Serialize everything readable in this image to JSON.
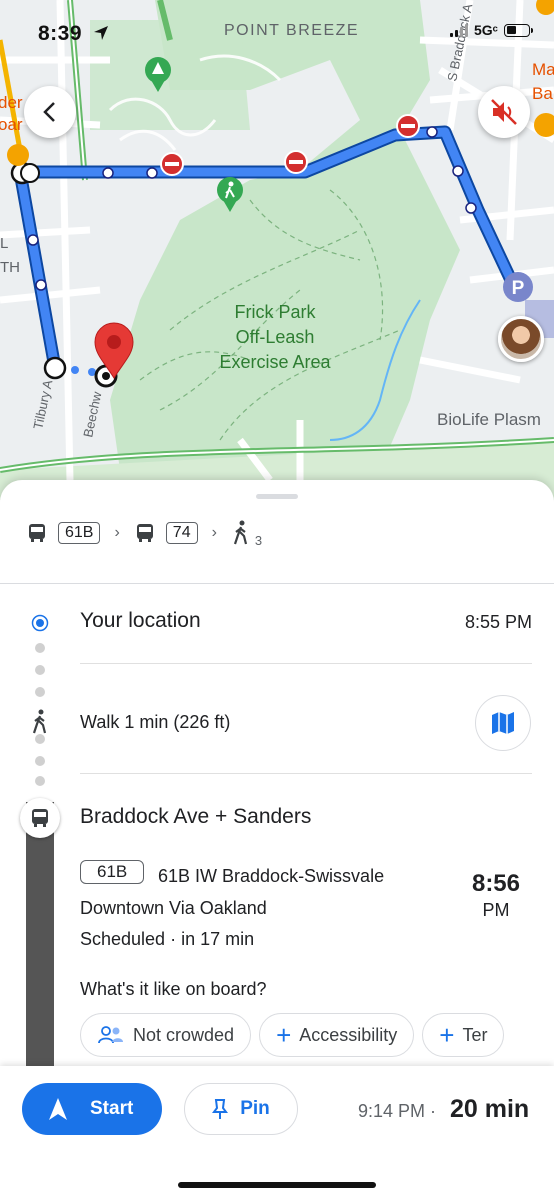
{
  "status_bar": {
    "time": "8:39",
    "network": "5Gᶜ"
  },
  "map": {
    "labels": {
      "neighborhood": "POINT BREEZE",
      "park": [
        "Frick Park",
        "Off-Leash",
        "Exercise Area"
      ],
      "place": "BioLife Plasm"
    },
    "street_labels": [
      "S Braddock A",
      "Tilbury A",
      "Beechw"
    ],
    "edge_labels": [
      "der",
      "oar",
      "Ma",
      "Ba",
      "L",
      "TH"
    ],
    "parking_label": "P",
    "route_color": "#1a73e8"
  },
  "summary": {
    "bus1": "61B",
    "bus2": "74",
    "walk_minutes": "3"
  },
  "steps": {
    "origin": {
      "label": "Your location",
      "time": "8:55 PM"
    },
    "walk": {
      "label": "Walk 1 min (226 ft)"
    },
    "stop": {
      "label": "Braddock Ave + Sanders"
    },
    "route": {
      "badge": "61B",
      "name": "61B IW Braddock-Swissvale",
      "destination": "Downtown Via Oakland",
      "schedule": "Scheduled · in 17 min",
      "depart_time": "8:56",
      "depart_ampm": "PM"
    },
    "crowd_question": "What's it like on board?",
    "chips": [
      "Not crowded",
      "Accessibility",
      "Ter"
    ]
  },
  "bottom": {
    "start_label": "Start",
    "pin_label": "Pin",
    "arrival": "9:14 PM ·",
    "duration": "20 min"
  },
  "colors": {
    "accent": "#1a73e8",
    "park": "#c8e6c9",
    "road_green": "#4caf50",
    "no_entry": "#d32f2f",
    "pin": "#e53935"
  }
}
